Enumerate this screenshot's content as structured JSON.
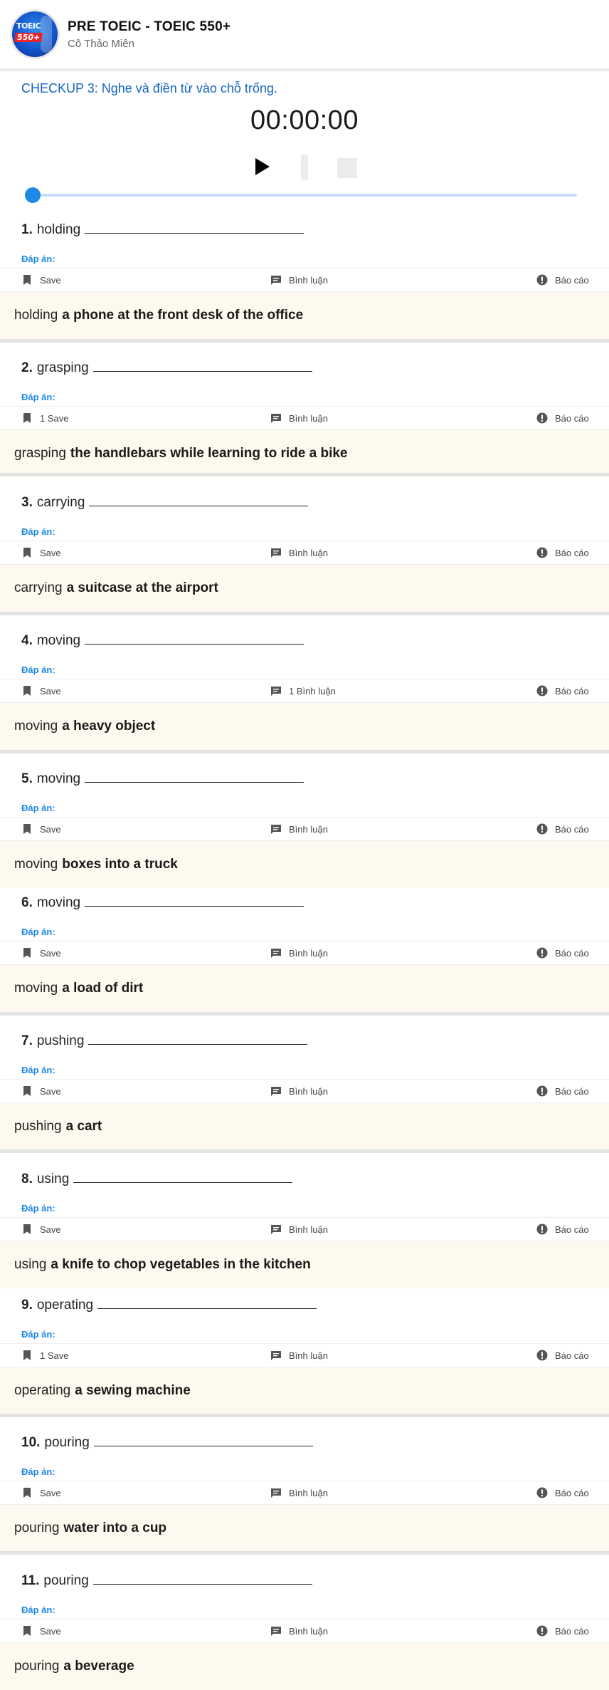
{
  "header": {
    "course_title": "PRE TOEIC - TOEIC 550+",
    "teacher": "Cô Thảo Miên",
    "avatar_logo": "TOEIC 550+"
  },
  "checkup": {
    "title": "CHECKUP 3: Nghe và điền từ vào chỗ trống."
  },
  "player": {
    "time": "00:00:00",
    "progress_fraction": 0,
    "icons": [
      "play-icon",
      "pause-icon",
      "stop-icon"
    ]
  },
  "labels": {
    "answer_label": "Đáp án:",
    "report": "Báo cáo"
  },
  "colors": {
    "accent": "#1e88e5",
    "title_blue": "#1565c0",
    "answer_bg": "#fdf9ee"
  },
  "questions": [
    {
      "num": "1.",
      "word": "holding",
      "save": "Save",
      "comment": "Bình luận",
      "answer_prefix": "holding",
      "answer_rest": "a phone at the front desk of the office"
    },
    {
      "num": "2.",
      "word": "grasping",
      "save": "1 Save",
      "comment": "Bình luận",
      "answer_prefix": "grasping",
      "answer_rest": "the handlebars while learning to ride a bike"
    },
    {
      "num": "3.",
      "word": "carrying",
      "save": "Save",
      "comment": "Bình luận",
      "answer_prefix": "carrying",
      "answer_rest": "a suitcase at the airport"
    },
    {
      "num": "4.",
      "word": "moving",
      "save": "Save",
      "comment": "1 Bình luận",
      "answer_prefix": "moving",
      "answer_rest": "a heavy object"
    },
    {
      "num": "5.",
      "word": "moving",
      "save": "Save",
      "comment": "Bình luận",
      "answer_prefix": "moving",
      "answer_rest": "boxes into a truck"
    },
    {
      "num": "6.",
      "word": "moving",
      "save": "Save",
      "comment": "Bình luận",
      "answer_prefix": "moving",
      "answer_rest": "a load of dirt"
    },
    {
      "num": "7.",
      "word": "pushing",
      "save": "Save",
      "comment": "Bình luận",
      "answer_prefix": "pushing",
      "answer_rest": "a cart"
    },
    {
      "num": "8.",
      "word": "using",
      "save": "Save",
      "comment": "Bình luận",
      "answer_prefix": "using",
      "answer_rest": "a knife to chop vegetables in the kitchen"
    },
    {
      "num": "9.",
      "word": "operating",
      "save": "1 Save",
      "comment": "Bình luận",
      "answer_prefix": "operating",
      "answer_rest": "a sewing machine"
    },
    {
      "num": "10.",
      "word": "pouring",
      "save": "Save",
      "comment": "Bình luận",
      "answer_prefix": "pouring",
      "answer_rest": "water into a cup"
    },
    {
      "num": "11.",
      "word": "pouring",
      "save": "Save",
      "comment": "Bình luận",
      "answer_prefix": "pouring",
      "answer_rest": "a beverage"
    }
  ]
}
